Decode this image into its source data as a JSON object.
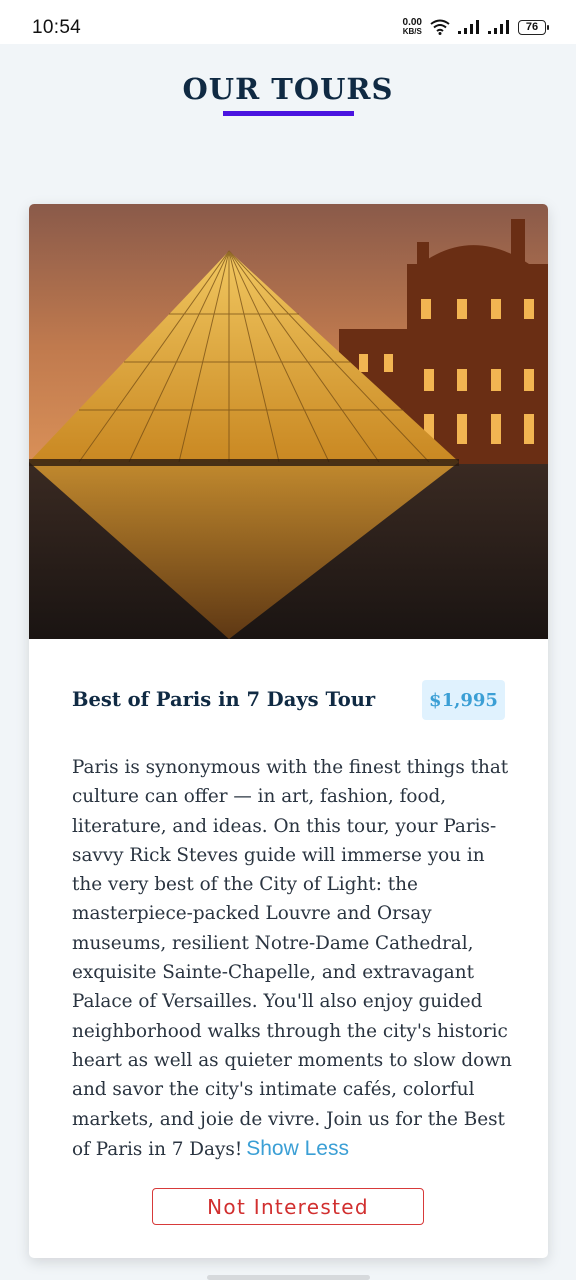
{
  "status_bar": {
    "time": "10:54",
    "net_speed_value": "0.00",
    "net_speed_unit": "KB/S",
    "battery": "76"
  },
  "header": {
    "title": "OUR TOURS",
    "accent_color": "#4a14e0"
  },
  "tour": {
    "name": "Best of Paris in 7 Days Tour",
    "price": "$1,995",
    "description": "Paris is synonymous with the finest things that culture can offer — in art, fashion, food, literature, and ideas. On this tour, your Paris-savvy Rick Steves guide will immerse you in the very best of the City of Light: the masterpiece-packed Louvre and Orsay museums, resilient Notre-Dame Cathedral, exquisite Sainte-Chapelle, and extravagant Palace of Versailles. You'll also enjoy guided neighborhood walks through the city's historic heart as well as quieter moments to slow down and savor the city's intimate cafés, colorful markets, and joie de vivre. Join us for the Best of Paris in 7 Days!",
    "toggle_label": "Show Less",
    "remove_label": "Not Interested",
    "image_icon": "louvre-pyramid-photo"
  }
}
